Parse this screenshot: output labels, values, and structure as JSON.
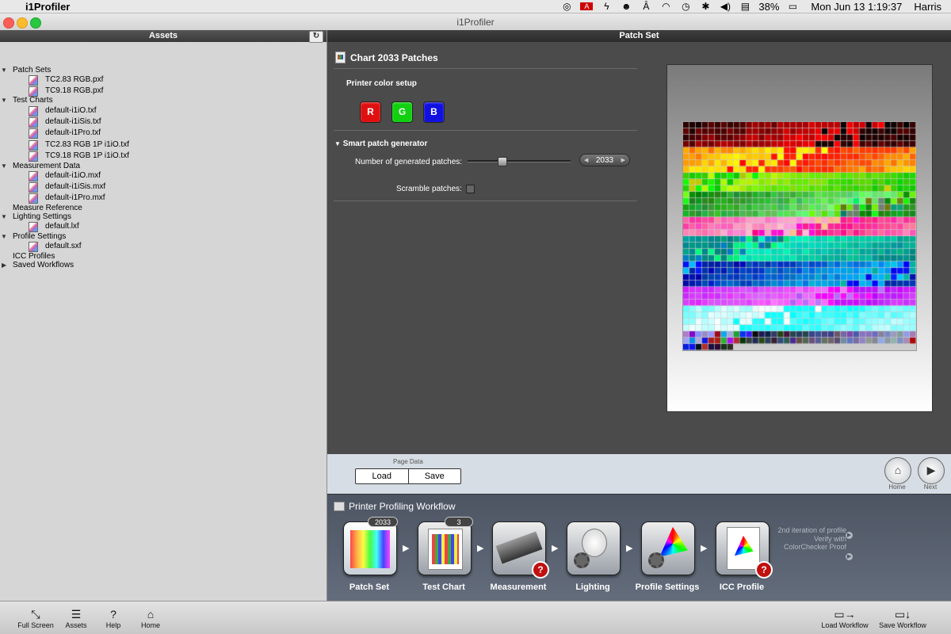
{
  "menubar": {
    "app_name": "i1Profiler",
    "battery": "38%",
    "datetime": "Mon Jun 13  1:19:37",
    "user": "Harris",
    "icons": [
      "apple-icon",
      "creative-cloud-icon",
      "adobe-icon",
      "bolt-icon",
      "face-icon",
      "lasso-icon",
      "wifi-icon",
      "time-machine-icon",
      "bluetooth-icon",
      "volume-icon",
      "flag-us-icon",
      "battery-icon"
    ]
  },
  "window": {
    "title": "i1Profiler"
  },
  "sidebar": {
    "header": "Assets",
    "tree": {
      "patch_sets": "Patch Sets",
      "patch_sets_items": [
        "TC2.83 RGB.pxf",
        "TC9.18 RGB.pxf"
      ],
      "test_charts": "Test Charts",
      "test_charts_items": [
        "default-i1iO.txf",
        "default-i1iSis.txf",
        "default-i1Pro.txf",
        "TC2.83 RGB 1P i1iO.txf",
        "TC9.18 RGB 1P i1iO.txf"
      ],
      "measurement_data": "Measurement Data",
      "measurement_items": [
        "default-i1iO.mxf",
        "default-i1iSis.mxf",
        "default-i1Pro.mxf"
      ],
      "measure_reference": "Measure Reference",
      "lighting_settings": "Lighting Settings",
      "lighting_items": [
        "default.lxf"
      ],
      "profile_settings": "Profile Settings",
      "profile_items": [
        "default.sxf"
      ],
      "icc_profiles": "ICC Profiles",
      "saved_workflows": "Saved Workflows"
    }
  },
  "main": {
    "header": "Patch Set",
    "chart_title": "Chart 2033 Patches",
    "printer_color_setup": "Printer color setup",
    "rgb": [
      "R",
      "G",
      "B"
    ],
    "smart_patch_generator": "Smart patch generator",
    "num_patches_label": "Number of generated patches:",
    "num_patches_value": "2033",
    "slider_level": 0.33,
    "scramble_label": "Scramble patches:",
    "scramble_checked": false
  },
  "footer": {
    "page_data_label": "Page Data",
    "load": "Load",
    "save": "Save",
    "home": "Home",
    "next": "Next"
  },
  "workflow": {
    "title": "Printer Profiling Workflow",
    "steps": [
      {
        "label": "Patch Set",
        "badge": "2033"
      },
      {
        "label": "Test Chart",
        "badge": "3"
      },
      {
        "label": "Measurement"
      },
      {
        "label": "Lighting"
      },
      {
        "label": "Profile Settings"
      },
      {
        "label": "ICC Profile"
      }
    ],
    "iteration_text": "2nd iteration of profile",
    "verify_text": "Verify with ColorChecker Proof"
  },
  "bottombar": {
    "full_screen": "Full Screen",
    "assets": "Assets",
    "help": "Help",
    "home": "Home",
    "load_workflow": "Load Workflow",
    "save_workflow": "Save Workflow"
  },
  "colors": {
    "accent_red": "#e01010",
    "accent_green": "#10d010",
    "accent_blue": "#1010e0",
    "workflow_bg": "#4d5563"
  }
}
